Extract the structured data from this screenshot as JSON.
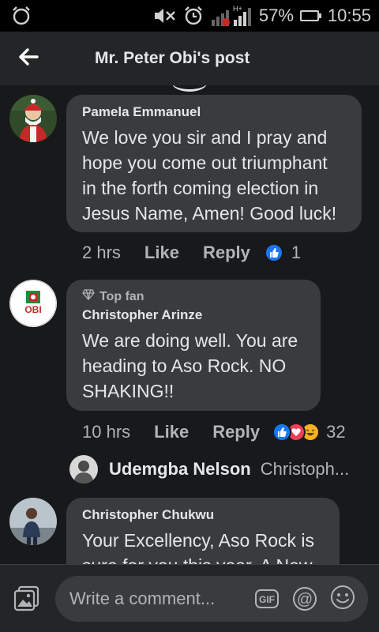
{
  "status_bar": {
    "battery_percent": "57%",
    "battery_level": 0.57,
    "time": "10:55",
    "network": "H+"
  },
  "header": {
    "title": "Mr. Peter Obi's post",
    "back_icon": "arrow-left-icon"
  },
  "comments": [
    {
      "author": "Pamela Emmanuel",
      "text": "We love you sir and I pray and hope you come out triumphant in the forth coming election in Jesus Name, Amen! Good luck!",
      "time": "2 hrs",
      "like_label": "Like",
      "reply_label": "Reply",
      "reaction_count": "1"
    },
    {
      "badge": "Top fan",
      "author": "Christopher Arinze",
      "avatar_text": "OBI",
      "text": "We are doing well. You are heading to Aso Rock. NO SHAKING!!",
      "time": "10 hrs",
      "like_label": "Like",
      "reply_label": "Reply",
      "reaction_count": "32",
      "reply_preview": {
        "author": "Udemgba Nelson",
        "snippet": "Christoph..."
      }
    },
    {
      "author": "Christopher Chukwu",
      "text": "Your Excellency, Aso Rock is sure for you this year. A New"
    }
  ],
  "composer": {
    "placeholder": "Write a comment...",
    "gif_label": "GIF",
    "at_label": "@"
  },
  "colors": {
    "background": "#18191a",
    "bubble": "#3a3b3c",
    "header": "#242526",
    "like_blue": "#1877f2",
    "love_red": "#f33e58",
    "haha_yellow": "#f7b125"
  }
}
